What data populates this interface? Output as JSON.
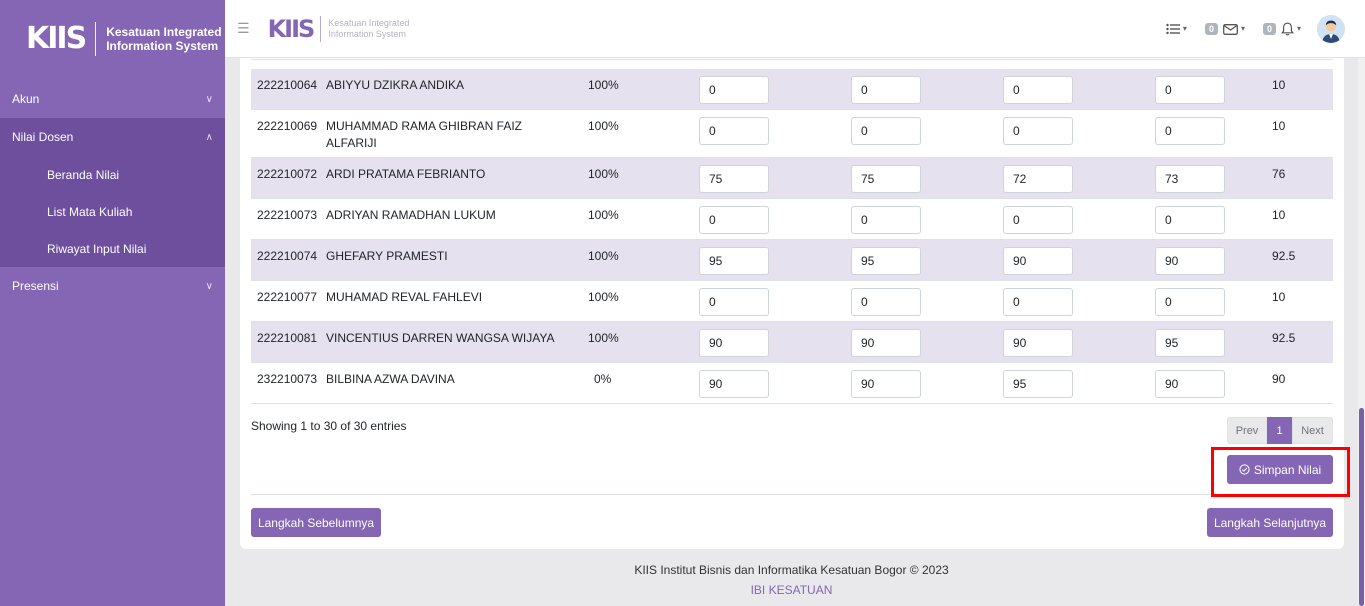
{
  "sidebar": {
    "logo": "KIIS",
    "title_line1": "Kesatuan Integrated",
    "title_line2": "Information System",
    "items": [
      {
        "label": "Akun"
      },
      {
        "label": "Nilai Dosen"
      },
      {
        "label": "Presensi"
      }
    ],
    "subitems": [
      {
        "label": "Beranda Nilai"
      },
      {
        "label": "List Mata Kuliah"
      },
      {
        "label": "Riwayat Input Nilai"
      }
    ]
  },
  "topbar": {
    "logo": "KIIS",
    "title_line1": "Kesatuan Integrated",
    "title_line2": "Information System",
    "messages_count": "0",
    "notifications_count": "0"
  },
  "table": {
    "rows": [
      {
        "nim": "222210064",
        "name": "ABIYYU DZIKRA ANDIKA",
        "pct": "100%",
        "v1": "0",
        "v2": "0",
        "v3": "0",
        "v4": "0",
        "final": "10"
      },
      {
        "nim": "222210069",
        "name": "MUHAMMAD RAMA GHIBRAN FAIZ ALFARIJI",
        "pct": "100%",
        "v1": "0",
        "v2": "0",
        "v3": "0",
        "v4": "0",
        "final": "10"
      },
      {
        "nim": "222210072",
        "name": "ARDI PRATAMA FEBRIANTO",
        "pct": "100%",
        "v1": "75",
        "v2": "75",
        "v3": "72",
        "v4": "73",
        "final": "76"
      },
      {
        "nim": "222210073",
        "name": "ADRIYAN RAMADHAN LUKUM",
        "pct": "100%",
        "v1": "0",
        "v2": "0",
        "v3": "0",
        "v4": "0",
        "final": "10"
      },
      {
        "nim": "222210074",
        "name": "GHEFARY PRAMESTI",
        "pct": "100%",
        "v1": "95",
        "v2": "95",
        "v3": "90",
        "v4": "90",
        "final": "92.5"
      },
      {
        "nim": "222210077",
        "name": "MUHAMAD REVAL FAHLEVI",
        "pct": "100%",
        "v1": "0",
        "v2": "0",
        "v3": "0",
        "v4": "0",
        "final": "10"
      },
      {
        "nim": "222210081",
        "name": "VINCENTIUS DARREN WANGSA WIJAYA",
        "pct": "100%",
        "v1": "90",
        "v2": "90",
        "v3": "90",
        "v4": "95",
        "final": "92.5"
      },
      {
        "nim": "232210073",
        "name": "BILBINA AZWA DAVINA",
        "pct": "0%",
        "v1": "90",
        "v2": "90",
        "v3": "95",
        "v4": "90",
        "final": "90"
      }
    ],
    "showing": "Showing 1 to 30 of 30 entries",
    "pager": {
      "prev": "Prev",
      "page": "1",
      "next": "Next"
    }
  },
  "actions": {
    "save": "Simpan Nilai",
    "previous_step": "Langkah Sebelumnya",
    "next_step": "Langkah Selanjutnya"
  },
  "footer": {
    "copyright": "KIIS Institut Bisnis dan Informatika Kesatuan Bogor © 2023",
    "link": "IBI KESATUAN"
  },
  "colors": {
    "accent": "#8466b5",
    "sidebar_active": "#6d4f9d",
    "highlight": "#ff0000"
  }
}
